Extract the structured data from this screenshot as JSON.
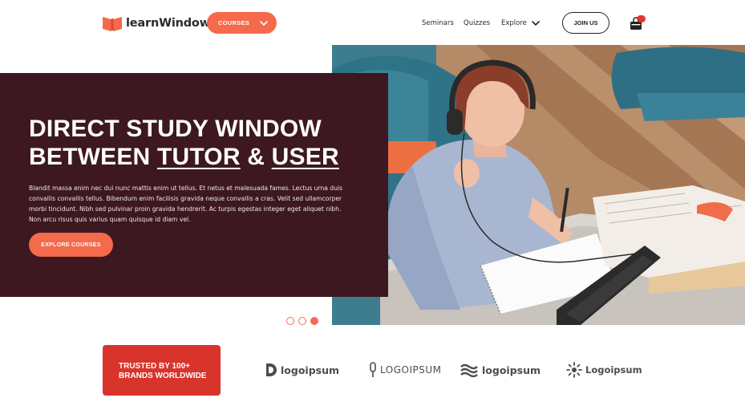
{
  "brand": {
    "name": "learnWindow",
    "accent": "#f46a4a",
    "hero_bg": "#3d1820",
    "trusted_bg": "#d9342b"
  },
  "header": {
    "courses_label": "COURSES",
    "nav": {
      "seminars": "Seminars",
      "quizzes": "Quizzes",
      "explore": "Explore"
    },
    "join_label": "JOIN US",
    "cart_icon": "shopping-bag-icon"
  },
  "hero": {
    "title_line1": "DIRECT STUDY WINDOW",
    "title_line2_prefix": "BETWEEN ",
    "title_word_tutor": "TUTOR",
    "title_amp": " & ",
    "title_word_user": "USER",
    "body": "Blandit massa enim nec dui nunc mattis enim ut tellus. Et netus et malesuada fames. Lectus urna duis convallis convallis tellus. Bibendum enim facilisis gravida neque convallis a cras. Velit sed ullamcorper morbi tincidunt. Nibh sed pulvinar proin gravida hendrerit. Ac turpis egestas integer eget aliquet nibh. Non arcu risus quis varius quam quisque id diam vel.",
    "cta_label": "EXPLORE COURSES",
    "image": "woman-studying-with-headphones-and-tablet",
    "carousel": {
      "slides": 3,
      "active": 3
    }
  },
  "trusted": {
    "line1": "TRUSTED BY 100+",
    "line2": "BRANDS WORLDWIDE"
  },
  "partners": [
    {
      "name": "logoipsum",
      "icon": "d-shape-icon"
    },
    {
      "name": "LOGOIPSUM",
      "icon": "microphone-shape-icon"
    },
    {
      "name": "logoipsum",
      "icon": "waves-icon"
    },
    {
      "name": "Logoipsum",
      "icon": "sunburst-icon"
    }
  ]
}
